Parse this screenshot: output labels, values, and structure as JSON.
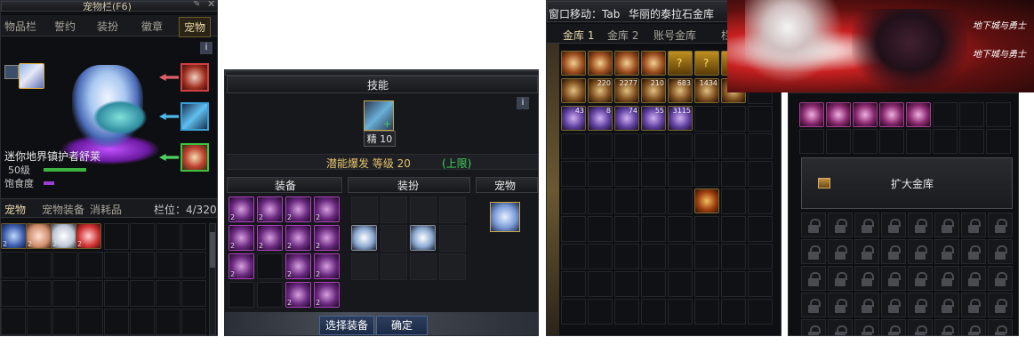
{
  "pet_panel": {
    "title": "宠物栏(F6)",
    "tabs": [
      "物品栏",
      "誓约",
      "装扮",
      "徽章",
      "宠物"
    ],
    "pet_name": "迷你地界镇护者舒莱",
    "level": "50级",
    "satiety_label": "饱食度",
    "bottom_tabs": [
      "宠物",
      "宠物装备",
      "消耗品"
    ],
    "slots_label": "栏位：4/320",
    "info_icon": "i"
  },
  "skill_panel": {
    "skill_header": "技能",
    "skill_badge": "精 10",
    "skill_line": "潜能爆发 等级 20",
    "skill_limit": "(上限)",
    "sections": [
      "装备",
      "装扮",
      "宠物"
    ],
    "btn_select": "选择装备",
    "btn_confirm": "确定",
    "info_icon": "i"
  },
  "vault_panel": {
    "title_move": "窗口移动：Tab",
    "title_name": "华丽的泰拉石金库",
    "tabs": [
      "金库 1",
      "金库 2",
      "账号金库",
      "栏"
    ],
    "row1_items": [
      "",
      "",
      "",
      "",
      "?",
      "?",
      "?"
    ],
    "row2_items": [
      "",
      "220",
      "2277",
      "210",
      "683",
      "1434",
      ""
    ],
    "row3_items": [
      "43",
      "8",
      "74",
      "55",
      "3115"
    ]
  },
  "expand_panel": {
    "expand_label": "扩大金库"
  },
  "banner": {
    "logo_top": "地下城与勇士",
    "logo_bottom": "地下城与勇士"
  },
  "colors": {
    "accent_gold": "#e8c46a",
    "quantity_yellow": "#e6c25a",
    "purple_bar": "#9a3fd1",
    "green_bar": "#3fb33f"
  }
}
